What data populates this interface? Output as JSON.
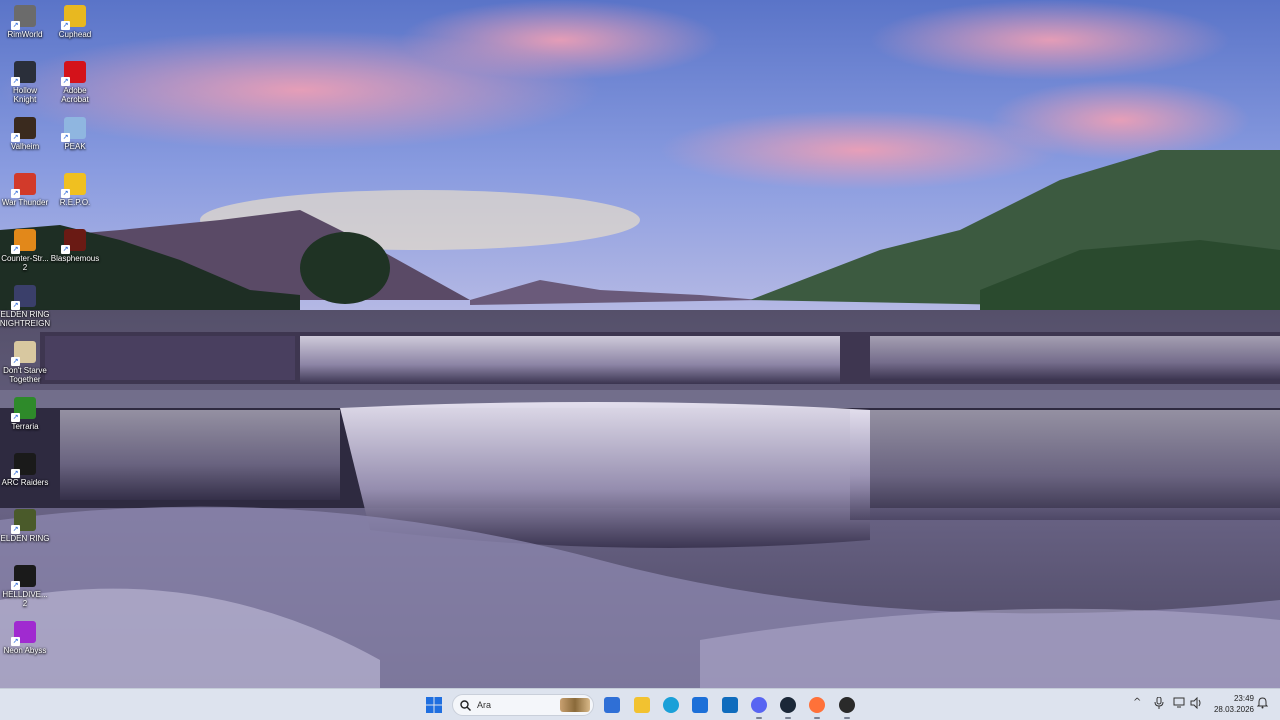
{
  "desktop": {
    "icons": [
      {
        "label": "RimWorld",
        "icon": "rimworld-icon",
        "color": "#6b6b6b"
      },
      {
        "label": "Cuphead",
        "icon": "cuphead-icon",
        "color": "#e8b820"
      },
      {
        "label": "Hollow\nKnight",
        "icon": "hollow-knight-icon",
        "color": "#2a2f3a"
      },
      {
        "label": "Adobe\nAcrobat",
        "icon": "adobe-acrobat-icon",
        "color": "#d4121a"
      },
      {
        "label": "Valheim",
        "icon": "valheim-icon",
        "color": "#3a2a1e"
      },
      {
        "label": "PEAK",
        "icon": "peak-icon",
        "color": "#8fb6e0"
      },
      {
        "label": "War Thunder",
        "icon": "war-thunder-icon",
        "color": "#d23a2a"
      },
      {
        "label": "R.E.P.O.",
        "icon": "repo-icon",
        "color": "#f0c020"
      },
      {
        "label": "Counter-Str...\n2",
        "icon": "counter-strike-icon",
        "color": "#e2881a"
      },
      {
        "label": "Blasphemous",
        "icon": "blasphemous-icon",
        "color": "#6a1a14"
      },
      {
        "label": "ELDEN RING\nNIGHTREIGN",
        "icon": "elden-ring-nightreign-icon",
        "color": "#3a3f6a"
      },
      {
        "label": "Don't Starve\nTogether",
        "icon": "dont-starve-together-icon",
        "color": "#d8c8a0"
      },
      {
        "label": "Terraria",
        "icon": "terraria-icon",
        "color": "#2e8a2a"
      },
      {
        "label": "ARC Raiders",
        "icon": "arc-raiders-icon",
        "color": "#1a1a1a"
      },
      {
        "label": "ELDEN RING",
        "icon": "elden-ring-icon",
        "color": "#4a5a2a"
      },
      {
        "label": "HELLDIVE...\n2",
        "icon": "helldivers-2-icon",
        "color": "#1a1a1a"
      },
      {
        "label": "Neon Abyss",
        "icon": "neon-abyss-icon",
        "color": "#a02ad0"
      }
    ]
  },
  "taskbar": {
    "start_icon": "windows-start-icon",
    "search": {
      "placeholder": "Ara"
    },
    "apps": [
      {
        "name": "widgets",
        "icon": "widgets-icon",
        "color": "#2f6fd6"
      },
      {
        "name": "file-explorer",
        "icon": "file-explorer-icon",
        "color": "#f2c230"
      },
      {
        "name": "edge",
        "icon": "edge-icon",
        "color": "#1aa0d8"
      },
      {
        "name": "store",
        "icon": "store-icon",
        "color": "#1c6fd8"
      },
      {
        "name": "outlook",
        "icon": "outlook-icon",
        "color": "#0f6cbd"
      },
      {
        "name": "discord",
        "icon": "discord-icon",
        "color": "#5865f2"
      },
      {
        "name": "steam",
        "icon": "steam-icon",
        "color": "#1b2838"
      },
      {
        "name": "firefox",
        "icon": "firefox-icon",
        "color": "#ff7139"
      },
      {
        "name": "app",
        "icon": "app-icon",
        "color": "#2a2a2a"
      }
    ],
    "tray": {
      "chevron": "^",
      "mic_icon": "microphone-icon",
      "network_icon": "network-icon",
      "volume_icon": "volume-icon",
      "notification_icon": "notification-bell-icon"
    },
    "clock": {
      "time": "23:49",
      "date": "28.03.2026"
    }
  }
}
